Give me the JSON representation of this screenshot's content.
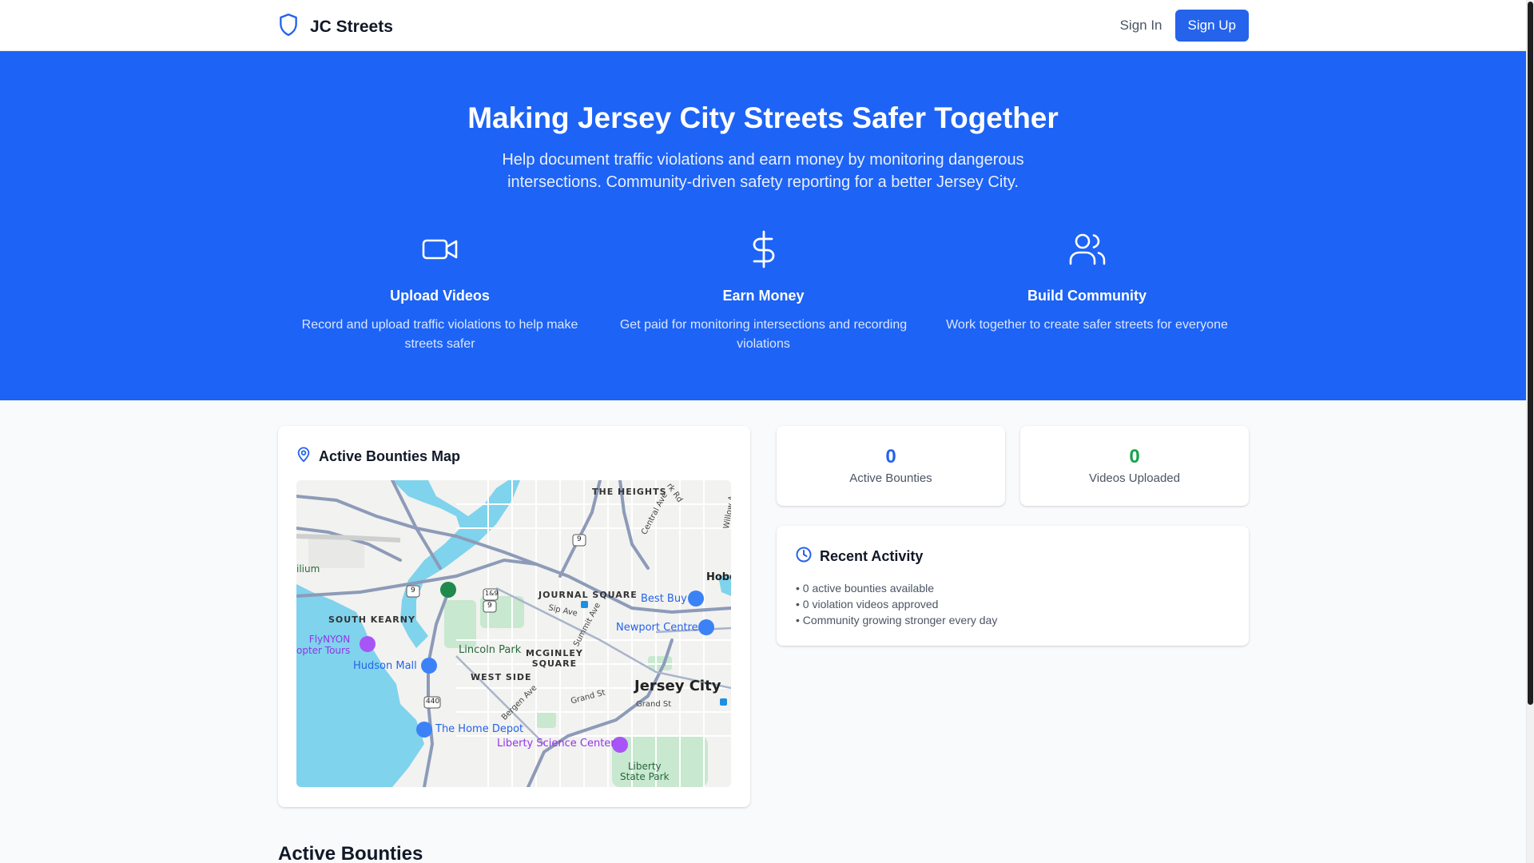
{
  "header": {
    "brand": "JC Streets",
    "signin_label": "Sign In",
    "signup_label": "Sign Up"
  },
  "hero": {
    "title": "Making Jersey City Streets Safer Together",
    "subtitle": "Help document traffic violations and earn money by monitoring dangerous intersections. Community-driven safety reporting for a better Jersey City.",
    "features": [
      {
        "icon": "video-icon",
        "title": "Upload Videos",
        "desc": "Record and upload traffic violations to help make streets safer"
      },
      {
        "icon": "dollar-icon",
        "title": "Earn Money",
        "desc": "Get paid for monitoring intersections and recording violations"
      },
      {
        "icon": "users-icon",
        "title": "Build Community",
        "desc": "Work together to create safer streets for everyone"
      }
    ]
  },
  "map_card": {
    "title": "Active Bounties Map",
    "labels": {
      "the_heights": "THE HEIGHTS",
      "journal_square": "JOURNAL SQUARE",
      "south_kearny": "SOUTH KEARNY",
      "mcginley_square": "MCGINLEY\nSQUARE",
      "west_side": "WEST SIDE",
      "jersey_city": "Jersey City",
      "lincoln_park": "Lincoln Park",
      "best_buy": "Best Buy",
      "newport_centre": "Newport Centre",
      "hudson_mall": "Hudson Mall",
      "the_home_depot": "The Home Depot",
      "liberty_science_center": "Liberty Science Center",
      "liberty_state_park": "Liberty\nState Park",
      "flynyon": "FlyNYON\nopter Tours",
      "ilium": "ilium",
      "hobo": "Hobo",
      "central_ave": "Central Ave",
      "summit_ave": "Summit Ave",
      "sip_ave": "Sip Ave",
      "bergen_ave": "Bergen Ave",
      "grand_st": "Grand St",
      "grand_st_2": "Grand St",
      "willow": "Willow A",
      "park_rd": "rk Rd",
      "route_9": "9",
      "route_9b": "9",
      "route_9c": "9",
      "route_440": "440",
      "route_1_9": "1&9"
    }
  },
  "stats": {
    "bounties_value": "0",
    "bounties_label": "Active Bounties",
    "videos_value": "0",
    "videos_label": "Videos Uploaded"
  },
  "activity": {
    "title": "Recent Activity",
    "items": [
      "• 0 active bounties available",
      "• 0 violation videos approved",
      "• Community growing stronger every day"
    ]
  },
  "bounties_section": {
    "title": "Active Bounties"
  },
  "colors": {
    "brand_blue": "#2563eb",
    "hero_blue": "#1d63f5",
    "stat_blue": "#2563eb",
    "stat_green": "#16a34a"
  }
}
